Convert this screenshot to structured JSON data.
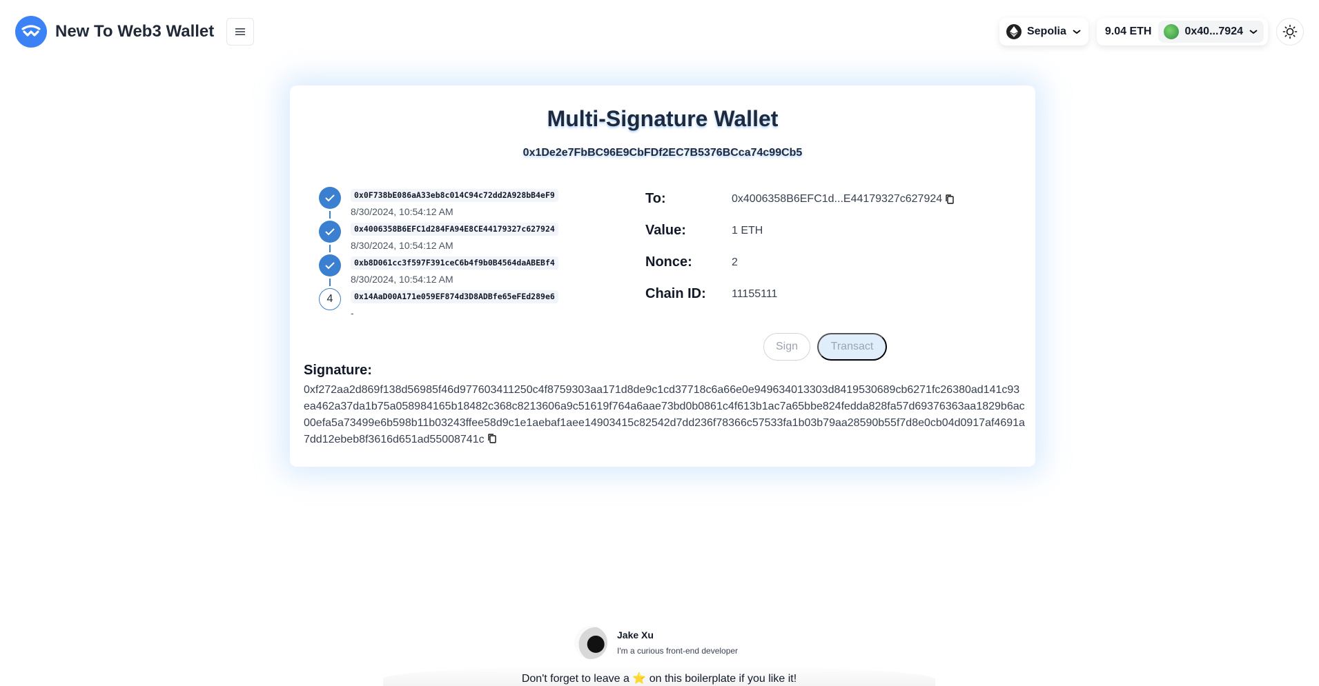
{
  "header": {
    "app_title": "New To Web3 Wallet",
    "network": "Sepolia",
    "balance": "9.04 ETH",
    "account": "0x40...7924"
  },
  "card": {
    "title": "Multi-Signature Wallet",
    "wallet_address": "0x1De2e7FbBC96E9CbFDf2EC7B5376BCca74c99Cb5",
    "signers": [
      {
        "address": "0x0F738bE086aA33eb8c014C94c72dd2A928bB4eF9",
        "time": "8/30/2024, 10:54:12 AM",
        "status": "signed"
      },
      {
        "address": "0x4006358B6EFC1d284FA94E8CE44179327c627924",
        "time": "8/30/2024, 10:54:12 AM",
        "status": "signed"
      },
      {
        "address": "0xb8D061cc3f597F391ceC6b4f9b0B4564daABEBf4",
        "time": "8/30/2024, 10:54:12 AM",
        "status": "signed"
      },
      {
        "address": "0x14AaD00A171e059EF874d3D8ADBfe65eFEd289e6",
        "time": "-",
        "status": "pending",
        "step": "4"
      }
    ],
    "details": {
      "to_label": "To:",
      "to_value": "0x4006358B6EFC1d...E44179327c627924",
      "value_label": "Value:",
      "value_value": "1 ETH",
      "nonce_label": "Nonce:",
      "nonce_value": "2",
      "chain_label": "Chain ID:",
      "chain_value": "11155111"
    },
    "buttons": {
      "sign": "Sign",
      "transact": "Transact"
    },
    "signature_label": "Signature:",
    "signature_value": "0xf272aa2d869f138d56985f46d977603411250c4f8759303aa171d8de9c1cd37718c6a66e0e949634013303d8419530689cb6271fc26380ad141c93ea462a37da1b75a058984165b18482c368c8213606a9c51619f764a6aae73bd0b0861c4f613b1ac7a65bbe824fedda828fa57d69376363aa1829b6ac00efa5a73499e6b598b11b03243ffee58d9c1e1aebaf1aee14903415c82542d7dd236f78366c57533fa1b03b79aa28590b55f7d8e0cb04d0917af4691a7dd12ebeb8f3616d651ad55008741c"
  },
  "footer": {
    "author_name": "Jake Xu",
    "author_bio": "I'm a curious front-end developer",
    "note": "Don't forget to leave a ⭐ on this boilerplate if you like it!"
  },
  "colors": {
    "accent": "#3b82f6",
    "step_blue": "#3b7fd0",
    "transact_bg": "#e0edfb"
  },
  "icons": [
    "wallet-logo-icon",
    "menu-icon",
    "ethereum-icon",
    "chevron-down-icon",
    "sun-icon",
    "check-icon",
    "copy-icon"
  ]
}
